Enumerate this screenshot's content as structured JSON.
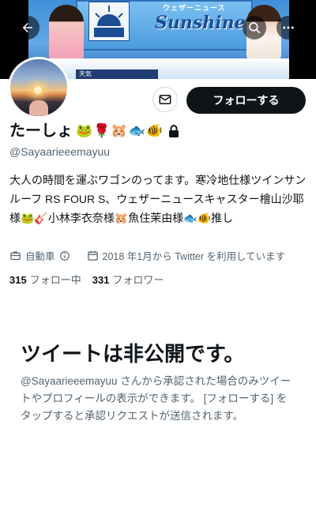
{
  "header": {
    "banner_logo_text": "Sunshine",
    "banner_logo_sub": "ウェザーニュース",
    "banner_ticker": "天気"
  },
  "profile": {
    "display_name": "たーしょ",
    "name_emojis": "🐸🌹🐹🐟🐠",
    "handle": "@Sayaarieeemayuu",
    "bio": "大人の時間を運ぶワゴンのってます。寒冷地仕様ツインサンルーフ RS FOUR S、ウェザーニュースキャスター檜山沙耶様🐸🎸小林李衣奈様🐹魚住茉由様🐟🐠推し",
    "category": "自動車",
    "joined": "2018 年1月から Twitter を利用しています",
    "following_count": "315",
    "following_label": "フォロー中",
    "followers_count": "331",
    "followers_label": "フォロワー"
  },
  "actions": {
    "follow_label": "フォローする"
  },
  "private_notice": {
    "title": "ツイートは非公開です。",
    "body": "@Sayaarieeemayuu さんから承認された場合のみツイートやプロフィールの表示ができます。 [フォローする] をタップすると承認リクエストが送信されます。"
  },
  "colors": {
    "text_primary": "#0f1419",
    "text_secondary": "#536471",
    "follow_button_bg": "#0f1419"
  }
}
